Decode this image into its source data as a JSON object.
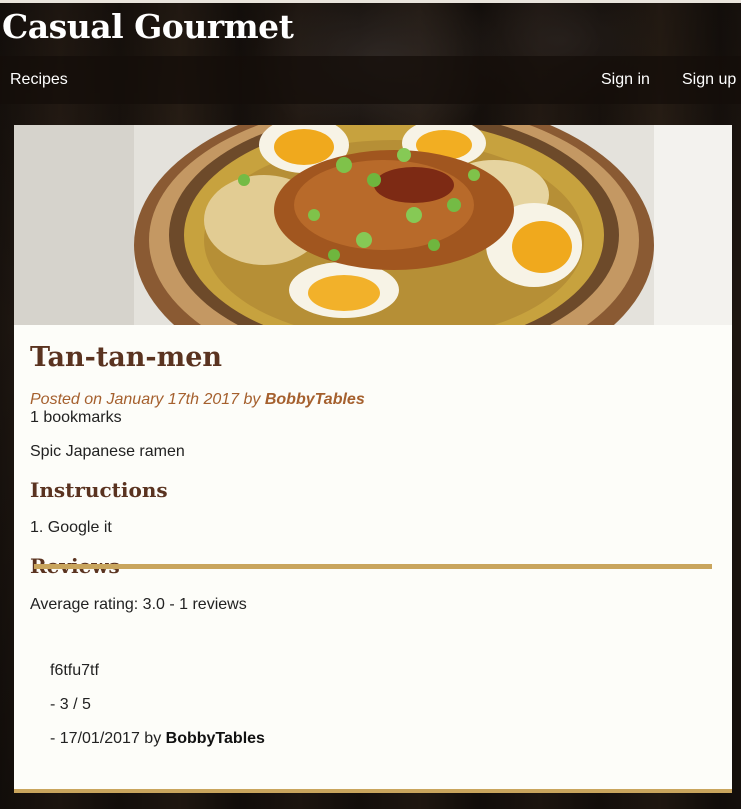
{
  "site": {
    "title": "Casual Gourmet"
  },
  "nav": {
    "recipes": "Recipes",
    "sign_in": "Sign in",
    "sign_up": "Sign up"
  },
  "recipe": {
    "title": "Tan-tan-men",
    "posted_prefix": "Posted on January 17th 2017 by",
    "author": "BobbyTables",
    "bookmarks": "1 bookmarks",
    "description": "Spic Japanese ramen",
    "instructions_heading": "Instructions",
    "instructions": [
      "1. Google it"
    ],
    "reviews_heading": "Reviews",
    "average_rating": "Average rating: 3.0 - 1 reviews"
  },
  "reviews": [
    {
      "text": "f6tfu7tf",
      "rating": "- 3 / 5",
      "date_prefix": "- 17/01/2017 by",
      "author": "BobbyTables"
    }
  ],
  "colors": {
    "accent_brown": "#5a3320",
    "meta_orange": "#a5602e",
    "gold": "#c9a55d",
    "card_bg": "#fdfdf9"
  },
  "icons": {
    "hero": "ramen-bowl-photo"
  }
}
